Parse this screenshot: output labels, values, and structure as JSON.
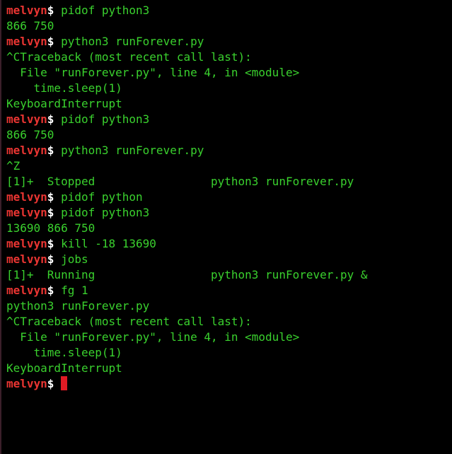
{
  "prompt": {
    "user": "melvyn",
    "sign": "$"
  },
  "colors": {
    "background": "#000000",
    "output": "#3ad12e",
    "user": "#ea3532",
    "sign": "#ffffff",
    "cursor": "#e01b24"
  },
  "lines": [
    {
      "type": "prompt",
      "text": " pidof python3"
    },
    {
      "type": "output",
      "text": "866 750"
    },
    {
      "type": "prompt",
      "text": " python3 runForever.py"
    },
    {
      "type": "output",
      "text": "^CTraceback (most recent call last):"
    },
    {
      "type": "output",
      "text": "  File \"runForever.py\", line 4, in <module>"
    },
    {
      "type": "output",
      "text": "    time.sleep(1)"
    },
    {
      "type": "output",
      "text": "KeyboardInterrupt"
    },
    {
      "type": "prompt",
      "text": " pidof python3"
    },
    {
      "type": "output",
      "text": "866 750"
    },
    {
      "type": "prompt",
      "text": " python3 runForever.py"
    },
    {
      "type": "output",
      "text": "^Z"
    },
    {
      "type": "output",
      "text": "[1]+  Stopped                 python3 runForever.py"
    },
    {
      "type": "prompt",
      "text": " pidof python"
    },
    {
      "type": "prompt",
      "text": " pidof python3"
    },
    {
      "type": "output",
      "text": "13690 866 750"
    },
    {
      "type": "prompt",
      "text": " kill -18 13690"
    },
    {
      "type": "prompt",
      "text": " jobs"
    },
    {
      "type": "output",
      "text": "[1]+  Running                 python3 runForever.py &"
    },
    {
      "type": "prompt",
      "text": " fg 1"
    },
    {
      "type": "output",
      "text": "python3 runForever.py"
    },
    {
      "type": "output",
      "text": "^CTraceback (most recent call last):"
    },
    {
      "type": "output",
      "text": "  File \"runForever.py\", line 4, in <module>"
    },
    {
      "type": "output",
      "text": "    time.sleep(1)"
    },
    {
      "type": "output",
      "text": "KeyboardInterrupt"
    },
    {
      "type": "cursor",
      "text": ""
    }
  ]
}
